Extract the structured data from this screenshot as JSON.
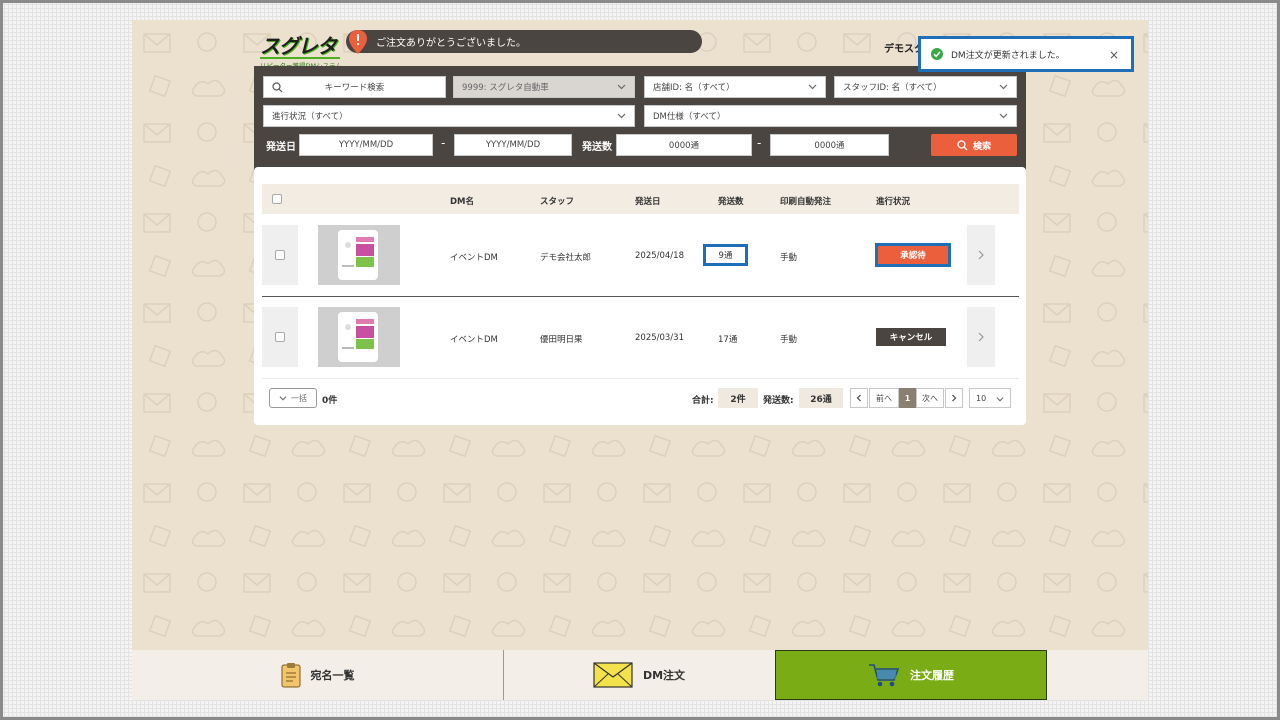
{
  "app": {
    "logo_main": "スグレタ",
    "logo_sub": "リピーター獲得DMシステム",
    "banner_text": "ご注文ありがとうございました。",
    "user_name": "デモスタ"
  },
  "toast": {
    "message": "DM注文が更新されました。",
    "close_label": "×"
  },
  "filters": {
    "keyword_placeholder": "キーワード検索",
    "company_select": "9999: スグレタ自動車",
    "store_select": "店舗ID: 名（すべて）",
    "staff_select": "スタッフID: 名（すべて）",
    "status_select": "進行状況（すべて）",
    "spec_select": "DM仕様（すべて）",
    "ship_date_label": "発送日",
    "date_from": "YYYY/MM/DD",
    "date_to": "YYYY/MM/DD",
    "range_sep": "-",
    "ship_count_label": "発送数",
    "count_from": "0000通",
    "count_to": "0000通",
    "search_label": "検索"
  },
  "table": {
    "headers": [
      "DM名",
      "スタッフ",
      "発送日",
      "発送数",
      "印刷自動発注",
      "進行状況"
    ],
    "rows": [
      {
        "dm_name": "イベントDM",
        "staff": "デモ会社太郎",
        "date": "2025/04/18",
        "count": "9通",
        "auto_order": "手動",
        "status": "承認待"
      },
      {
        "dm_name": "イベントDM",
        "staff": "優田明日果",
        "date": "2025/03/31",
        "count": "17通",
        "auto_order": "手動",
        "status": "キャンセル"
      }
    ]
  },
  "footer": {
    "bulk_label": "一括",
    "selected_count": "0件",
    "total_label": "合計:",
    "total_value": "2件",
    "ship_total_label": "発送数:",
    "ship_total_value": "26通",
    "prev_label": "前へ",
    "page_current": "1",
    "next_label": "次へ",
    "per_page": "10"
  },
  "nav": {
    "items": [
      {
        "label": "宛名一覧",
        "icon": "clipboard-icon"
      },
      {
        "label": "DM注文",
        "icon": "envelope-icon"
      },
      {
        "label": "注文履歴",
        "icon": "cart-icon"
      }
    ]
  },
  "colors": {
    "accent_orange": "#ec5f3d",
    "panel_dark": "#4a4540",
    "nav_active_green": "#7aac16",
    "highlight_blue": "#1f6fb8"
  }
}
